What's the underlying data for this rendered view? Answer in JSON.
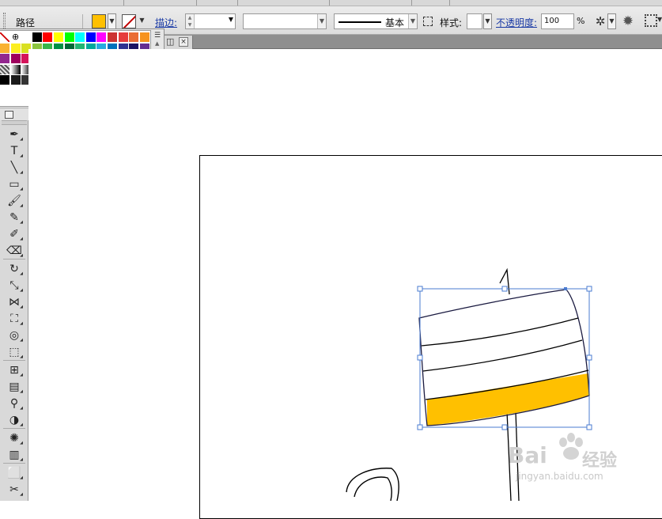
{
  "control_bar": {
    "object_label": "路径",
    "fill_color": "#ffc000",
    "stroke_label": "描边:",
    "brush_label": "基本",
    "style_label": "样式:",
    "opacity_label": "不透明度:",
    "opacity_value": "100",
    "opacity_unit": "%"
  },
  "swatches": {
    "rows": [
      [
        "none-swatch",
        "registration-swatch",
        "#ffffff",
        "#000000",
        "#ff0000",
        "#ffff00",
        "#00ff00",
        "#00ffff",
        "#0000ff",
        "#ff00ff",
        "#cc3333",
        "#e63c3c",
        "#ea6d35",
        "#f7931e"
      ],
      [
        "#f9b233",
        "#fcee21",
        "#d9e021",
        "#8cc63f",
        "#39b54a",
        "#009245",
        "#006837",
        "#22b573",
        "#00a99d",
        "#29abe2",
        "#0071bc",
        "#2e3192",
        "#1b1464",
        "#662d91"
      ],
      [
        "#93278f",
        "#9e005d",
        "#d4145a",
        "#ed1e79",
        "#c7b299",
        "#998675",
        "#736357",
        "#534741",
        "#c69c6d",
        "#a67c52",
        "#8c6239",
        "#754c24",
        "#603813",
        "#42210b"
      ],
      [
        "pattern-swatch",
        "gradient-swatch",
        "gradient-swatch-2",
        "gradient-swatch-3",
        "pattern-swatch-2"
      ],
      [
        "#000000",
        "#1a1a1a",
        "#333333",
        "#4d4d4d",
        "#666666",
        "#808080",
        "#999999",
        "#b3b3b3",
        "#cccccc",
        "#e6e6e6",
        "#f2f2f2"
      ]
    ]
  },
  "doc_tab": {
    "close_glyph": "×"
  },
  "tools": [
    "pen-tool",
    "type-tool",
    "line-tool",
    "rectangle-tool",
    "paintbrush-tool",
    "pencil-tool",
    "blob-brush-tool",
    "eraser-tool",
    "rotate-tool",
    "scale-tool",
    "width-tool",
    "free-transform-tool",
    "shape-builder-tool",
    "perspective-grid-tool",
    "mesh-tool",
    "gradient-tool",
    "eyedropper-tool",
    "blend-tool",
    "symbol-sprayer-tool",
    "column-graph-tool",
    "artboard-tool",
    "slice-tool"
  ],
  "watermark": {
    "brand": "Bai",
    "brand_suffix": "经验",
    "url": "jingyan.baidu.com"
  },
  "colors": {
    "selection_blue": "#4a7bd0",
    "fill_yellow": "#ffc000",
    "link_blue": "#1a3aa5"
  }
}
